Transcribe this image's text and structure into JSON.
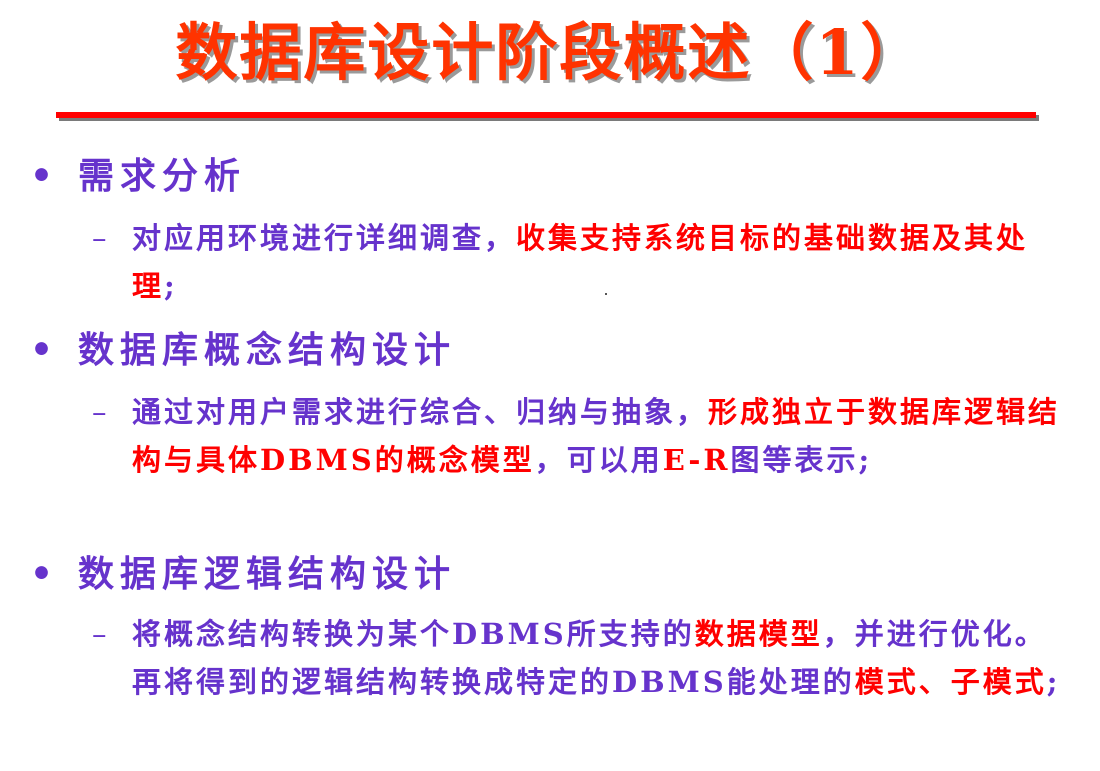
{
  "title": "数据库设计阶段概述（1）",
  "bullet_marker": "•",
  "sub_marker": "–",
  "sections": [
    {
      "heading": "需求分析",
      "detail": [
        {
          "text": "对应用环境进行详细调查，",
          "color": "purple"
        },
        {
          "text": "收集支持系统目标的基础数据及其处理",
          "color": "red"
        },
        {
          "text": ";",
          "color": "purple"
        }
      ]
    },
    {
      "heading": "数据库概念结构设计",
      "detail": [
        {
          "text": "通过对用户需求进行综合、归纳与抽象，",
          "color": "purple"
        },
        {
          "text": "形成独立于数据库逻辑结构与具体DBMS的概念模型",
          "color": "red"
        },
        {
          "text": "，可以用",
          "color": "purple"
        },
        {
          "text": "E-R",
          "color": "red"
        },
        {
          "text": "图等表示;",
          "color": "purple"
        }
      ]
    },
    {
      "heading": "数据库逻辑结构设计",
      "detail": [
        {
          "text": "将概念结构转换为某个DBMS所支持的",
          "color": "purple"
        },
        {
          "text": "数据模型",
          "color": "red"
        },
        {
          "text": "，并进行优化。再将得到的逻辑结构转换成特定的DBMS能处理的",
          "color": "purple"
        },
        {
          "text": "模式、子模式",
          "color": "red"
        },
        {
          "text": ";",
          "color": "purple"
        }
      ]
    }
  ],
  "colors": {
    "title": "#ff3300",
    "divider": "#ff0000",
    "text": "#6633cc",
    "highlight": "#ff0000"
  }
}
